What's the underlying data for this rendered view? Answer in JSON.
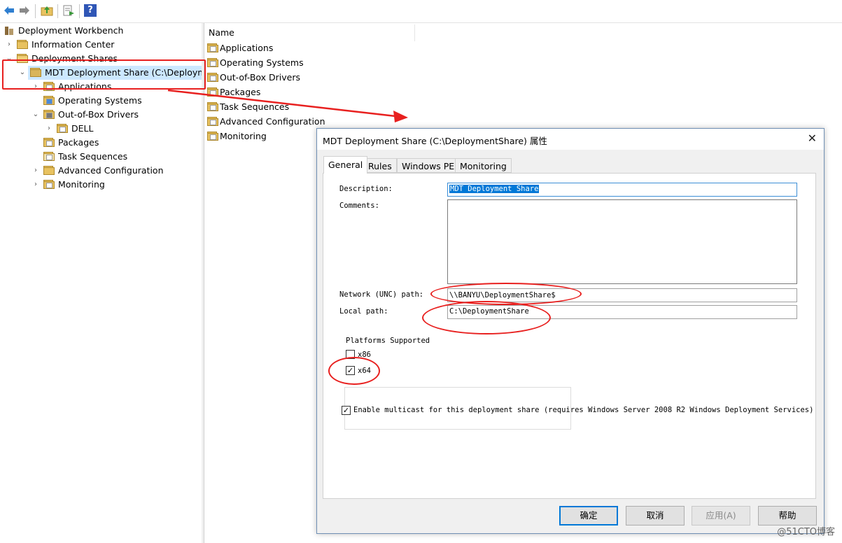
{
  "toolbar": {
    "icons": [
      "back-arrow-icon",
      "forward-arrow-icon",
      "up-folder-icon",
      "export-list-icon",
      "help-icon"
    ],
    "help_glyph": "?"
  },
  "tree": {
    "root": "Deployment Workbench",
    "information_center": "Information Center",
    "deployment_shares": "Deployment Shares",
    "share": "MDT Deployment Share (C:\\Deployme",
    "applications": "Applications",
    "operating_systems": "Operating Systems",
    "out_of_box_drivers": "Out-of-Box Drivers",
    "dell": "DELL",
    "packages": "Packages",
    "task_sequences": "Task Sequences",
    "advanced_configuration": "Advanced Configuration",
    "monitoring": "Monitoring"
  },
  "list": {
    "column_name": "Name",
    "items": [
      "Applications",
      "Operating Systems",
      "Out-of-Box Drivers",
      "Packages",
      "Task Sequences",
      "Advanced Configuration",
      "Monitoring"
    ]
  },
  "dialog": {
    "title": "MDT Deployment Share (C:\\DeploymentShare) 属性",
    "close_glyph": "✕",
    "tabs": [
      "General",
      "Rules",
      "Windows PE",
      "Monitoring"
    ],
    "active_tab": "General",
    "description_label": "Description:",
    "description_value": "MDT Deployment Share",
    "comments_label": "Comments:",
    "comments_value": "",
    "unc_label": "Network (UNC) path:",
    "unc_value": "\\\\BANYU\\DeploymentShare$",
    "local_label": "Local path:",
    "local_value": "C:\\DeploymentShare",
    "platforms_label": "Platforms Supported",
    "x86_label": "x86",
    "x86_checked": false,
    "x64_label": "x64",
    "x64_checked": true,
    "multicast_label": "Enable multicast for this deployment share (requires Windows Server 2008 R2 Windows Deployment Services)",
    "multicast_checked": true,
    "buttons": {
      "ok": "确定",
      "cancel": "取消",
      "apply": "应用(A)",
      "help": "帮助"
    },
    "check_glyph": "✓"
  },
  "watermark": "@51CTO博客",
  "colors": {
    "annotation": "#e8201f",
    "selection": "#cce8ff",
    "accent": "#0078d7",
    "folder": "#e8c260"
  }
}
